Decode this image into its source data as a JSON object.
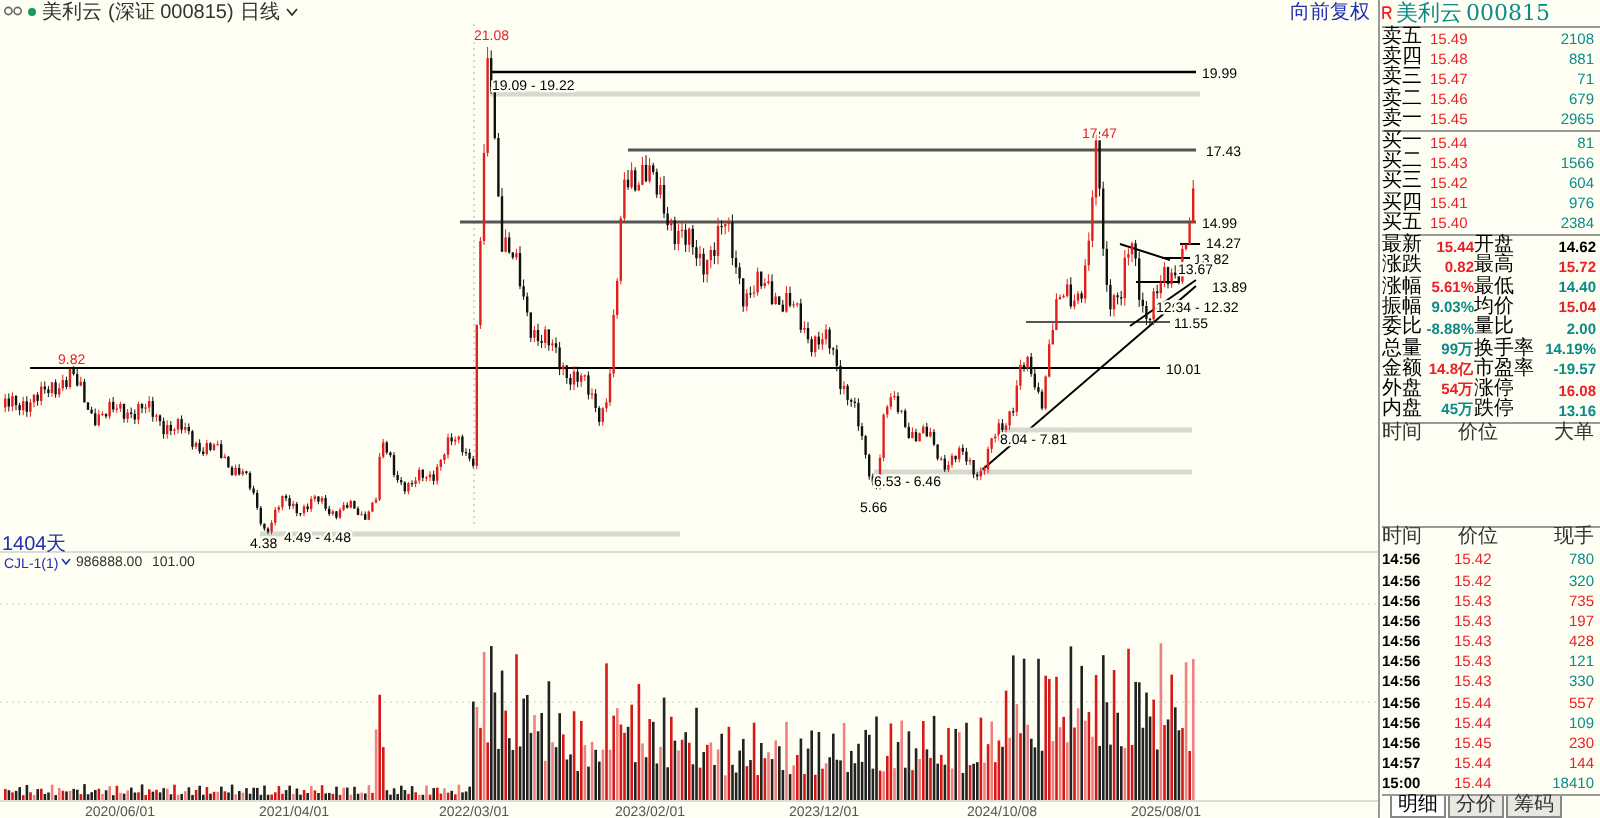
{
  "header": {
    "name": "美利云",
    "code": "(深证 000815)",
    "period": "日线",
    "adjust": "向前复权"
  },
  "chart": {
    "annotations": [
      {
        "text": "21.08",
        "color": "#e8202a"
      },
      {
        "text": "19.09 - 19.22",
        "color": "#000000"
      },
      {
        "text": "19.99",
        "color": "#000000"
      },
      {
        "text": "17.47",
        "color": "#e8202a"
      },
      {
        "text": "17.43",
        "color": "#000000"
      },
      {
        "text": "14.99",
        "color": "#000000"
      },
      {
        "text": "14.27",
        "color": "#000000"
      },
      {
        "text": "13.82",
        "color": "#000000"
      },
      {
        "text": "13.67",
        "color": "#000000"
      },
      {
        "text": "13.89",
        "color": "#000000"
      },
      {
        "text": "12.34 - 12.32",
        "color": "#000000"
      },
      {
        "text": "11.55",
        "color": "#000000"
      },
      {
        "text": "10.01",
        "color": "#000000"
      },
      {
        "text": "8.04 - 7.81",
        "color": "#000000"
      },
      {
        "text": "6.53 - 6.46",
        "color": "#000000"
      },
      {
        "text": "5.66",
        "color": "#000000"
      },
      {
        "text": "9.82",
        "color": "#e8202a"
      },
      {
        "text": "4.38",
        "color": "#000000"
      },
      {
        "text": "4.49 - 4.48",
        "color": "#000000"
      }
    ],
    "span": "1404天",
    "indicator": {
      "name": "CJL-1(1)",
      "values": [
        "986888.00",
        "101.00"
      ]
    },
    "date_labels": [
      "2020/06/01",
      "2021/04/01",
      "2022/03/01",
      "2023/02/01",
      "2023/12/01",
      "2024/10/08",
      "2025/08/01"
    ]
  },
  "quote": {
    "name": "美利云",
    "code": "000815",
    "order_book": [
      {
        "label": "卖五",
        "price": "15.49",
        "volume": "2108"
      },
      {
        "label": "卖四",
        "price": "15.48",
        "volume": "881"
      },
      {
        "label": "卖三",
        "price": "15.47",
        "volume": "71"
      },
      {
        "label": "卖二",
        "price": "15.46",
        "volume": "679"
      },
      {
        "label": "卖一",
        "price": "15.45",
        "volume": "2965"
      },
      {
        "label": "买一",
        "price": "15.44",
        "volume": "81"
      },
      {
        "label": "买二",
        "price": "15.43",
        "volume": "1566"
      },
      {
        "label": "买三",
        "price": "15.42",
        "volume": "604"
      },
      {
        "label": "买四",
        "price": "15.41",
        "volume": "976"
      },
      {
        "label": "买五",
        "price": "15.40",
        "volume": "2384"
      }
    ],
    "stats": [
      {
        "label": "最新",
        "value": "15.44",
        "color": "#e8202a"
      },
      {
        "label": "开盘",
        "value": "14.62",
        "color": "#000000"
      },
      {
        "label": "涨跌",
        "value": "0.82",
        "color": "#e8202a"
      },
      {
        "label": "最高",
        "value": "15.72",
        "color": "#e8202a"
      },
      {
        "label": "涨幅",
        "value": "5.61%",
        "color": "#e8202a"
      },
      {
        "label": "最低",
        "value": "14.40",
        "color": "#0a8a8a"
      },
      {
        "label": "振幅",
        "value": "9.03%",
        "color": "#0a8a8a"
      },
      {
        "label": "均价",
        "value": "15.04",
        "color": "#e8202a"
      },
      {
        "label": "委比",
        "value": "-8.88%",
        "color": "#0a8a8a"
      },
      {
        "label": "量比",
        "value": "2.00",
        "color": "#0a8a8a"
      },
      {
        "label": "总量",
        "value": "99万",
        "color": "#0a8a8a"
      },
      {
        "label": "换手率",
        "value": "14.19%",
        "color": "#0a8a8a"
      },
      {
        "label": "金额",
        "value": "14.8亿",
        "color": "#e8202a"
      },
      {
        "label": "市盈率",
        "value": "-19.57",
        "color": "#0a8a8a"
      },
      {
        "label": "外盘",
        "value": "54万",
        "color": "#e8202a"
      },
      {
        "label": "涨停",
        "value": "16.08",
        "color": "#e8202a"
      },
      {
        "label": "内盘",
        "value": "45万",
        "color": "#0a8a8a"
      },
      {
        "label": "跌停",
        "value": "13.16",
        "color": "#0a8a8a"
      }
    ],
    "big_trades": {
      "columns": [
        "时间",
        "价位",
        "大单"
      ]
    },
    "ticks": {
      "columns": [
        "时间",
        "价位",
        "现手"
      ],
      "rows": [
        {
          "time": "14:56",
          "price": "15.42",
          "volume": "780",
          "color": "#0a8a8a"
        },
        {
          "time": "14:56",
          "price": "15.42",
          "volume": "320",
          "color": "#0a8a8a"
        },
        {
          "time": "14:56",
          "price": "15.43",
          "volume": "735",
          "color": "#e8202a"
        },
        {
          "time": "14:56",
          "price": "15.43",
          "volume": "197",
          "color": "#e8202a"
        },
        {
          "time": "14:56",
          "price": "15.43",
          "volume": "428",
          "color": "#e8202a"
        },
        {
          "time": "14:56",
          "price": "15.43",
          "volume": "121",
          "color": "#0a8a8a"
        },
        {
          "time": "14:56",
          "price": "15.43",
          "volume": "330",
          "color": "#0a8a8a"
        },
        {
          "time": "14:56",
          "price": "15.44",
          "volume": "557",
          "color": "#e8202a"
        },
        {
          "time": "14:56",
          "price": "15.44",
          "volume": "109",
          "color": "#0a8a8a"
        },
        {
          "time": "14:56",
          "price": "15.45",
          "volume": "230",
          "color": "#e8202a"
        },
        {
          "time": "14:57",
          "price": "15.44",
          "volume": "144",
          "color": "#e8202a"
        },
        {
          "time": "15:00",
          "price": "15.44",
          "volume": "18410",
          "color": "#0a8a8a"
        }
      ]
    },
    "tabs": [
      {
        "label": "明细",
        "selected": true
      },
      {
        "label": "分价",
        "selected": false
      },
      {
        "label": "筹码",
        "selected": false
      }
    ]
  }
}
